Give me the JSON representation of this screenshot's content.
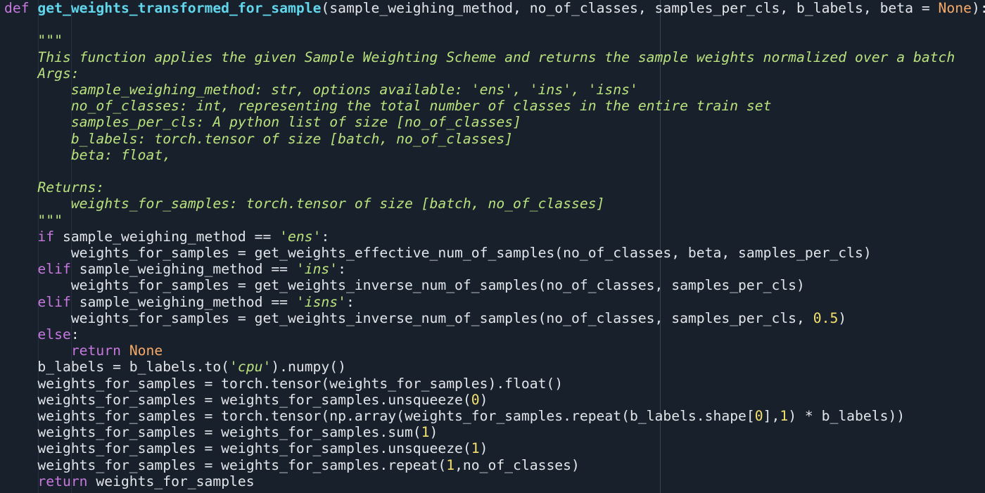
{
  "editor": {
    "colors": {
      "background": "#18202c",
      "plain": "#e2e6ea",
      "keyword": "#c678dd",
      "function_name": "#61d6ea",
      "constant": "#f7a968",
      "string": "#b9e27d",
      "docstring": "#b9e27d",
      "number": "#f5e16e"
    },
    "lines": [
      [
        {
          "t": "def ",
          "c": "#c678dd"
        },
        {
          "t": "get_weights_transformed_for_sample",
          "c": "#61d6ea",
          "b": true
        },
        {
          "t": "(sample_weighing_method, no_of_classes, samples_per_cls, b_labels, beta = ",
          "c": "#e2e6ea"
        },
        {
          "t": "None",
          "c": "#f7a968"
        },
        {
          "t": "):",
          "c": "#e2e6ea"
        }
      ],
      [],
      [
        {
          "t": "    \"\"\"",
          "c": "#b9e27d"
        }
      ],
      [
        {
          "t": "    This function applies the given Sample Weighting Scheme and returns the sample weights normalized over a batch",
          "c": "#b9e27d",
          "i": true
        }
      ],
      [
        {
          "t": "    Args:",
          "c": "#b9e27d",
          "i": true
        }
      ],
      [
        {
          "t": "        sample_weighing_method: str, options available: 'ens', 'ins', 'isns'",
          "c": "#b9e27d",
          "i": true
        }
      ],
      [
        {
          "t": "        no_of_classes: int, representing the total number of classes in the entire train set",
          "c": "#b9e27d",
          "i": true
        }
      ],
      [
        {
          "t": "        samples_per_cls: A python list of size [no_of_classes]",
          "c": "#b9e27d",
          "i": true
        }
      ],
      [
        {
          "t": "        b_labels: torch.tensor of size [batch, no_of_classes]",
          "c": "#b9e27d",
          "i": true
        }
      ],
      [
        {
          "t": "        beta: float,",
          "c": "#b9e27d",
          "i": true
        }
      ],
      [],
      [
        {
          "t": "    Returns:",
          "c": "#b9e27d",
          "i": true
        }
      ],
      [
        {
          "t": "        weights_for_samples: torch.tensor of size [batch, no_of_classes]",
          "c": "#b9e27d",
          "i": true
        }
      ],
      [
        {
          "t": "    \"\"\"",
          "c": "#b9e27d"
        }
      ],
      [
        {
          "t": "    ",
          "c": "#e2e6ea"
        },
        {
          "t": "if",
          "c": "#c678dd"
        },
        {
          "t": " sample_weighing_method == ",
          "c": "#e2e6ea"
        },
        {
          "t": "'ens'",
          "c": "#b9e27d",
          "i": true
        },
        {
          "t": ":",
          "c": "#e2e6ea"
        }
      ],
      [
        {
          "t": "        weights_for_samples = get_weights_effective_num_of_samples(no_of_classes, beta, samples_per_cls)",
          "c": "#e2e6ea"
        }
      ],
      [
        {
          "t": "    ",
          "c": "#e2e6ea"
        },
        {
          "t": "elif",
          "c": "#c678dd"
        },
        {
          "t": " sample_weighing_method == ",
          "c": "#e2e6ea"
        },
        {
          "t": "'ins'",
          "c": "#b9e27d",
          "i": true
        },
        {
          "t": ":",
          "c": "#e2e6ea"
        }
      ],
      [
        {
          "t": "        weights_for_samples = get_weights_inverse_num_of_samples(no_of_classes, samples_per_cls)",
          "c": "#e2e6ea"
        }
      ],
      [
        {
          "t": "    ",
          "c": "#e2e6ea"
        },
        {
          "t": "elif",
          "c": "#c678dd"
        },
        {
          "t": " sample_weighing_method == ",
          "c": "#e2e6ea"
        },
        {
          "t": "'isns'",
          "c": "#b9e27d",
          "i": true
        },
        {
          "t": ":",
          "c": "#e2e6ea"
        }
      ],
      [
        {
          "t": "        weights_for_samples = get_weights_inverse_num_of_samples(no_of_classes, samples_per_cls, ",
          "c": "#e2e6ea"
        },
        {
          "t": "0.5",
          "c": "#f5e16e"
        },
        {
          "t": ")",
          "c": "#e2e6ea"
        }
      ],
      [
        {
          "t": "    ",
          "c": "#e2e6ea"
        },
        {
          "t": "else",
          "c": "#c678dd"
        },
        {
          "t": ":",
          "c": "#e2e6ea"
        }
      ],
      [
        {
          "t": "        ",
          "c": "#e2e6ea"
        },
        {
          "t": "return",
          "c": "#c678dd"
        },
        {
          "t": " ",
          "c": "#e2e6ea"
        },
        {
          "t": "None",
          "c": "#f7a968"
        }
      ],
      [
        {
          "t": "    b_labels = b_labels.to(",
          "c": "#e2e6ea"
        },
        {
          "t": "'cpu'",
          "c": "#b9e27d",
          "i": true
        },
        {
          "t": ").numpy()",
          "c": "#e2e6ea"
        }
      ],
      [
        {
          "t": "    weights_for_samples = torch.tensor(weights_for_samples).float()",
          "c": "#e2e6ea"
        }
      ],
      [
        {
          "t": "    weights_for_samples = weights_for_samples.unsqueeze(",
          "c": "#e2e6ea"
        },
        {
          "t": "0",
          "c": "#f5e16e"
        },
        {
          "t": ")",
          "c": "#e2e6ea"
        }
      ],
      [
        {
          "t": "    weights_for_samples = torch.tensor(np.array(weights_for_samples.repeat(b_labels.shape[",
          "c": "#e2e6ea"
        },
        {
          "t": "0",
          "c": "#f5e16e"
        },
        {
          "t": "],",
          "c": "#e2e6ea"
        },
        {
          "t": "1",
          "c": "#f5e16e"
        },
        {
          "t": ") * b_labels))",
          "c": "#e2e6ea"
        }
      ],
      [
        {
          "t": "    weights_for_samples = weights_for_samples.sum(",
          "c": "#e2e6ea"
        },
        {
          "t": "1",
          "c": "#f5e16e"
        },
        {
          "t": ")",
          "c": "#e2e6ea"
        }
      ],
      [
        {
          "t": "    weights_for_samples = weights_for_samples.unsqueeze(",
          "c": "#e2e6ea"
        },
        {
          "t": "1",
          "c": "#f5e16e"
        },
        {
          "t": ")",
          "c": "#e2e6ea"
        }
      ],
      [
        {
          "t": "    weights_for_samples = weights_for_samples.repeat(",
          "c": "#e2e6ea"
        },
        {
          "t": "1",
          "c": "#f5e16e"
        },
        {
          "t": ",no_of_classes)",
          "c": "#e2e6ea"
        }
      ],
      [
        {
          "t": "    ",
          "c": "#e2e6ea"
        },
        {
          "t": "return",
          "c": "#c678dd"
        },
        {
          "t": " weights_for_samples",
          "c": "#e2e6ea"
        }
      ]
    ]
  }
}
